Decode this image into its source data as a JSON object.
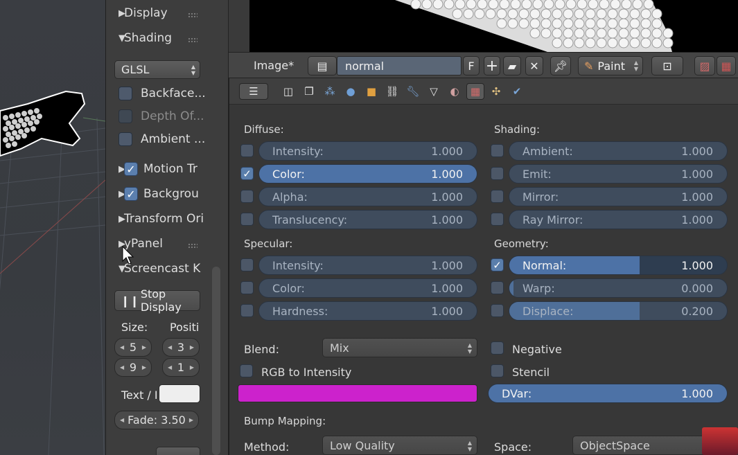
{
  "toolshelf": {
    "display": "Display",
    "shading": "Shading",
    "shading_mode": "GLSL",
    "backface": "Backface...",
    "depth_of": "Depth Of...",
    "ambient": "Ambient ...",
    "motion_tr": "Motion Tr",
    "backgrou": "Backgrou",
    "transform_ori": "Transform Ori",
    "ypanel": "yPanel",
    "screencast": "Screencast K",
    "stop_display": "Stop Display",
    "size_label": "Size:",
    "position_label": "Positi",
    "size_a": "5",
    "size_b": "9",
    "pos_a": "3",
    "pos_b": "1",
    "text_label": "Text / I",
    "fade": "Fade: 3.50"
  },
  "header": {
    "label": "Image*",
    "texture_name": "normal",
    "fake_user": "F",
    "paint": "Paint"
  },
  "diffuse": {
    "title": "Diffuse:",
    "rows": [
      {
        "label": "Intensity:",
        "value": "1.000",
        "checked": false
      },
      {
        "label": "Color:",
        "value": "1.000",
        "checked": true
      },
      {
        "label": "Alpha:",
        "value": "1.000",
        "checked": false
      },
      {
        "label": "Translucency:",
        "value": "1.000",
        "checked": false
      }
    ]
  },
  "shading": {
    "title": "Shading:",
    "rows": [
      {
        "label": "Ambient:",
        "value": "1.000",
        "checked": false
      },
      {
        "label": "Emit:",
        "value": "1.000",
        "checked": false
      },
      {
        "label": "Mirror:",
        "value": "1.000",
        "checked": false
      },
      {
        "label": "Ray Mirror:",
        "value": "1.000",
        "checked": false
      }
    ]
  },
  "specular": {
    "title": "Specular:",
    "rows": [
      {
        "label": "Intensity:",
        "value": "1.000",
        "checked": false
      },
      {
        "label": "Color:",
        "value": "1.000",
        "checked": false
      },
      {
        "label": "Hardness:",
        "value": "1.000",
        "checked": false
      }
    ]
  },
  "geometry": {
    "title": "Geometry:",
    "rows": [
      {
        "label": "Normal:",
        "value": "1.000",
        "checked": true
      },
      {
        "label": "Warp:",
        "value": "0.000",
        "checked": false
      },
      {
        "label": "Displace:",
        "value": "0.200",
        "checked": false
      }
    ]
  },
  "blend": {
    "label": "Blend:",
    "value": "Mix",
    "rgb_to_intensity": "RGB to Intensity",
    "negative": "Negative",
    "stencil": "Stencil",
    "dvar_label": "DVar:",
    "dvar_value": "1.000",
    "swatch_color": "#cc22cc"
  },
  "bump": {
    "title": "Bump Mapping:",
    "method_label": "Method:",
    "method_value": "Low Quality",
    "space_label": "Space:",
    "space_value": "ObjectSpace"
  },
  "colors": {
    "accent": "#5a7eab",
    "slider_fill": "#4f6f99"
  }
}
